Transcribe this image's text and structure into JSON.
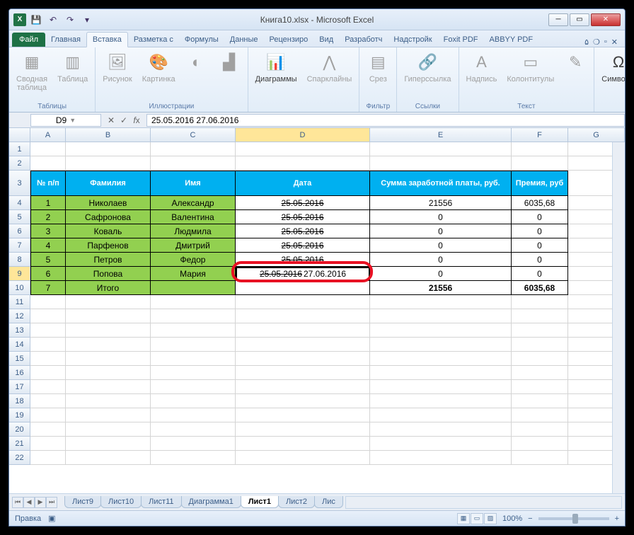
{
  "window": {
    "title": "Книга10.xlsx - Microsoft Excel"
  },
  "ribbon": {
    "file": "Файл",
    "tabs": [
      "Главная",
      "Вставка",
      "Разметка с",
      "Формулы",
      "Данные",
      "Рецензиро",
      "Вид",
      "Разработч",
      "Надстройк",
      "Foxit PDF",
      "ABBYY PDF"
    ],
    "active_tab": 1,
    "groups": {
      "tables": {
        "label": "Таблицы",
        "pivot": "Сводная\nтаблица",
        "table": "Таблица"
      },
      "illustrations": {
        "label": "Иллюстрации",
        "picture": "Рисунок",
        "clipart": "Картинка"
      },
      "charts": {
        "label": " ",
        "charts": "Диаграммы",
        "sparklines": "Спарклайны"
      },
      "filter": {
        "label": "Фильтр",
        "slicer": "Срез"
      },
      "links": {
        "label": "Ссылки",
        "hyperlink": "Гиперссылка"
      },
      "text": {
        "label": "Текст",
        "textbox": "Надпись",
        "headerfooter": "Колонтитулы"
      },
      "symbols": {
        "label": " ",
        "symbols": "Символы"
      }
    }
  },
  "formula_bar": {
    "cell_ref": "D9",
    "value": "25.05.2016 27.06.2016"
  },
  "columns": [
    "A",
    "B",
    "C",
    "D",
    "E",
    "F",
    "G"
  ],
  "row_headers": [
    1,
    2,
    3,
    4,
    5,
    6,
    7,
    8,
    9,
    10,
    11,
    12,
    13,
    14,
    15,
    16,
    17,
    18,
    19,
    20,
    21,
    22
  ],
  "table": {
    "headers": {
      "num": "№ п/п",
      "surname": "Фамилия",
      "name": "Имя",
      "date": "Дата",
      "salary": "Сумма заработной платы, руб.",
      "bonus": "Премия, руб"
    },
    "rows": [
      {
        "n": "1",
        "s": "Николаев",
        "i": "Александр",
        "d": "25.05.2016",
        "sal": "21556",
        "b": "6035,68"
      },
      {
        "n": "2",
        "s": "Сафронова",
        "i": "Валентина",
        "d": "25.05.2016",
        "sal": "0",
        "b": "0"
      },
      {
        "n": "3",
        "s": "Коваль",
        "i": "Людмила",
        "d": "25.05.2016",
        "sal": "0",
        "b": "0"
      },
      {
        "n": "4",
        "s": "Парфенов",
        "i": "Дмитрий",
        "d": "25.05.2016",
        "sal": "0",
        "b": "0"
      },
      {
        "n": "5",
        "s": "Петров",
        "i": "Федор",
        "d": "25.05.2016",
        "sal": "0",
        "b": "0"
      },
      {
        "n": "6",
        "s": "Попова",
        "i": "Мария",
        "d_old": "25.05.2016",
        "d_new": "27.06.2016",
        "sal": "0",
        "b": "0"
      },
      {
        "n": "7",
        "s": "Итого",
        "i": "",
        "d": "",
        "sal": "21556",
        "b": "6035,68"
      }
    ]
  },
  "sheets": {
    "nav": [
      "⏮",
      "◀",
      "▶",
      "⏭"
    ],
    "tabs": [
      "Лист9",
      "Лист10",
      "Лист11",
      "Диаграмма1",
      "Лист1",
      "Лист2",
      "Лис"
    ],
    "active": 4
  },
  "statusbar": {
    "mode": "Правка",
    "zoom": "100%"
  }
}
